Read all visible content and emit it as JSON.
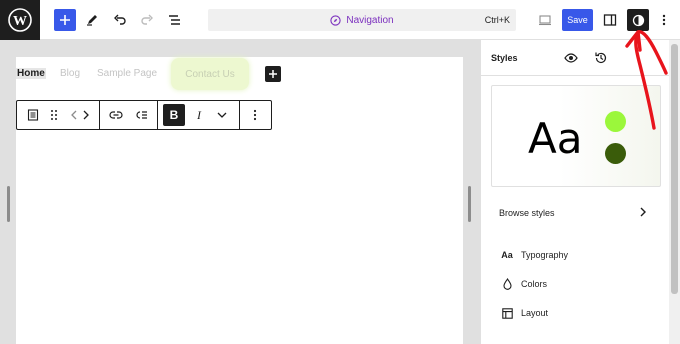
{
  "topbar": {
    "command_center_title": "Navigation",
    "command_center_shortcut": "Ctrl+K",
    "save_label": "Save"
  },
  "canvas": {
    "nav_links": [
      "Home",
      "Blog",
      "Sample Page",
      "Contact Us"
    ]
  },
  "sidebar": {
    "title": "Styles",
    "preview_text": "Aa",
    "preview_colors": [
      "#9bf73b",
      "#3a5c0a"
    ],
    "browse_styles": "Browse styles",
    "menu": [
      {
        "label": "Typography",
        "icon": "typography-icon"
      },
      {
        "label": "Colors",
        "icon": "droplet-icon"
      },
      {
        "label": "Layout",
        "icon": "layout-icon"
      }
    ]
  },
  "colors": {
    "accent": "#3858e9",
    "annotation_arrow": "#e8141c"
  }
}
